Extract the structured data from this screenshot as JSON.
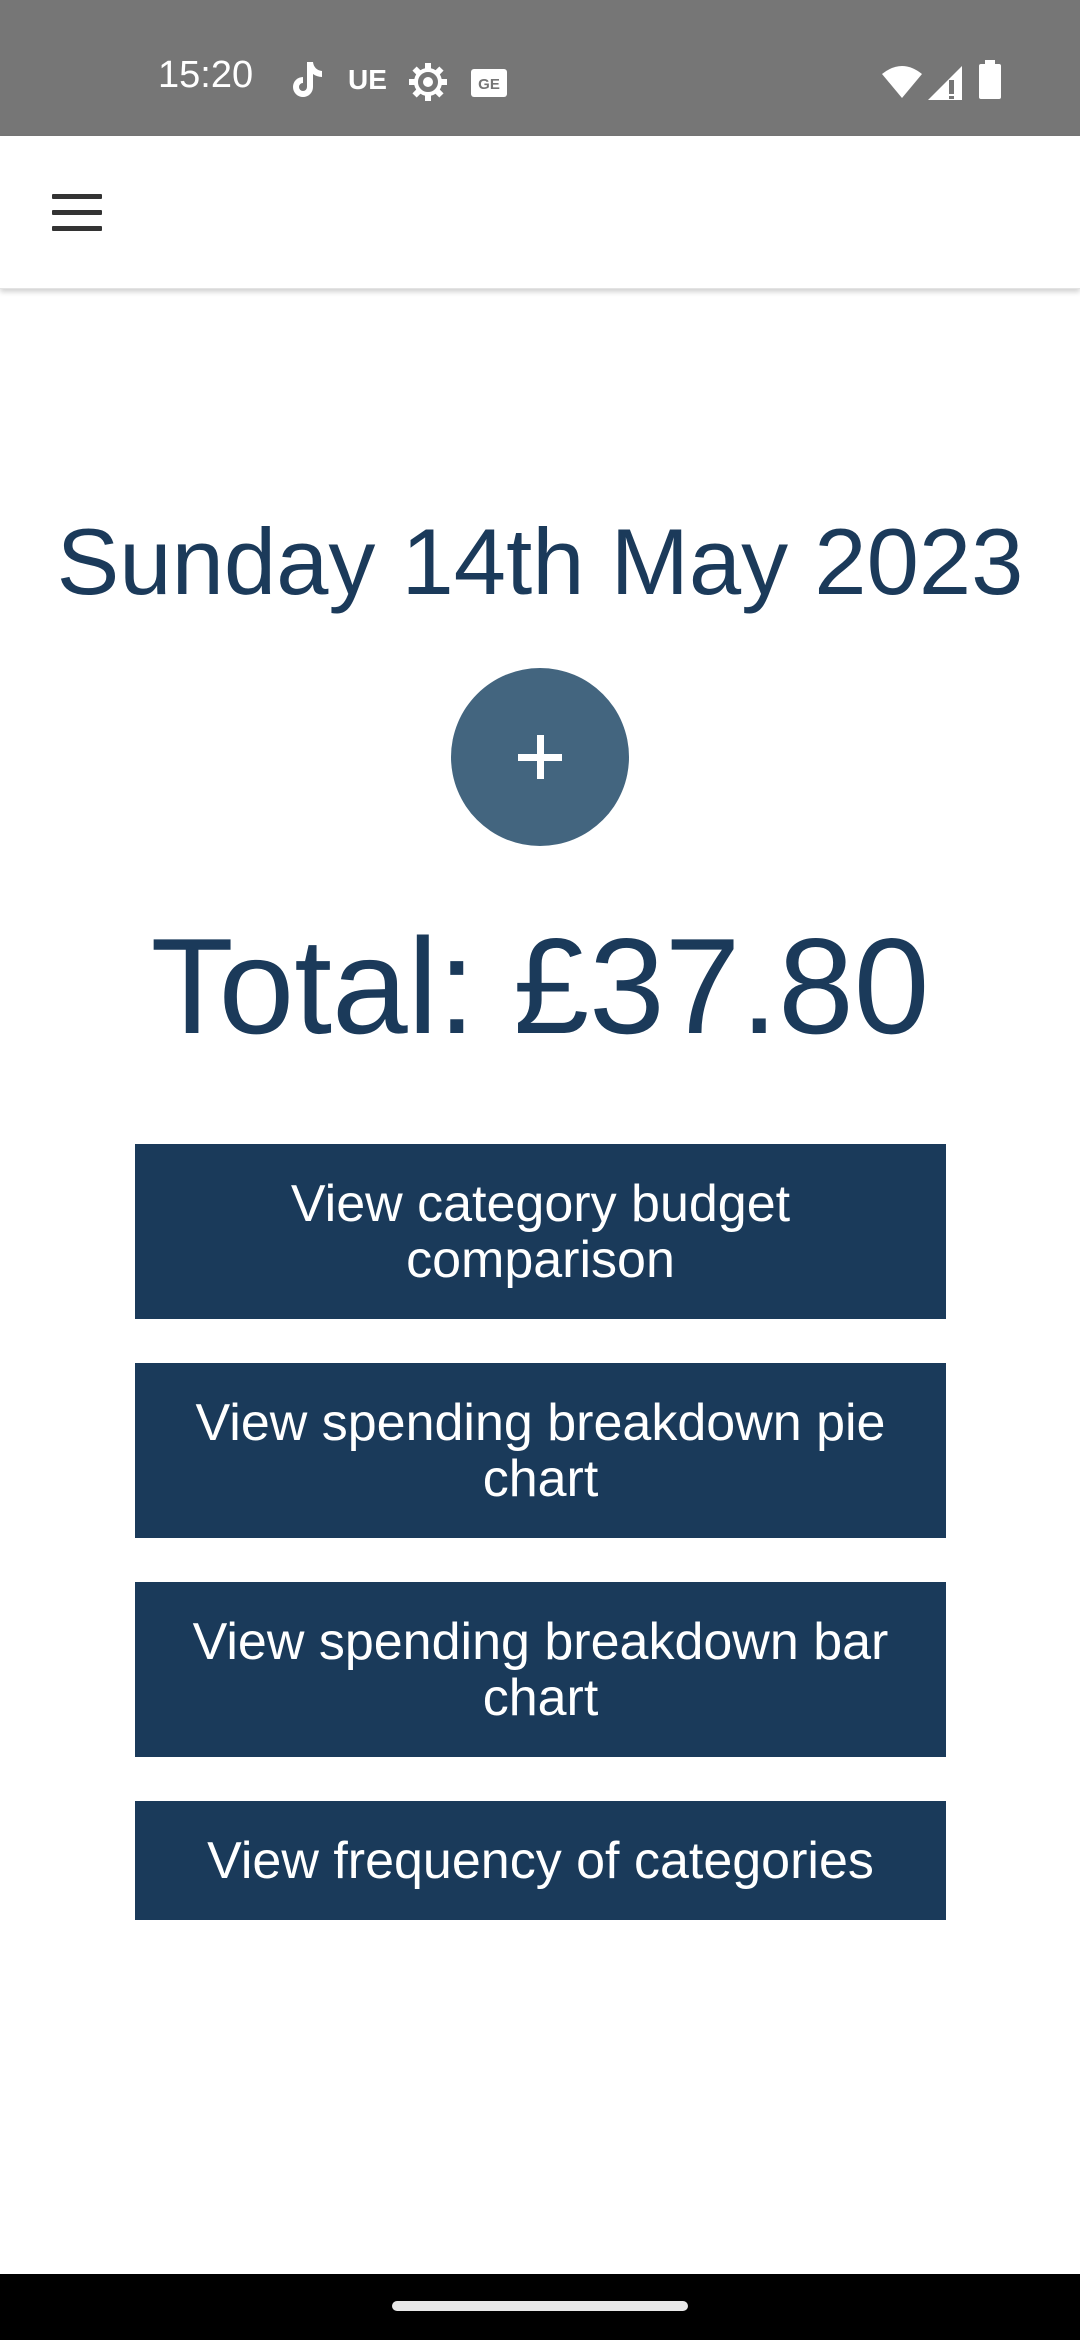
{
  "status_bar": {
    "time": "15:20",
    "notification_icons": [
      "tiktok-icon",
      "ue-icon",
      "settings-gear-icon",
      "ge-icon"
    ],
    "ue_label": "UE",
    "system_icons": [
      "wifi-icon",
      "signal-icon",
      "battery-icon"
    ]
  },
  "app_bar": {
    "menu_icon": "hamburger-menu-icon"
  },
  "main": {
    "date": "Sunday 14th May 2023",
    "add_button_icon": "plus-icon",
    "total": "Total: £37.80",
    "buttons": [
      {
        "label": "View category budget comparison"
      },
      {
        "label": "View spending breakdown pie chart"
      },
      {
        "label": "View spending breakdown bar chart"
      },
      {
        "label": "View frequency of categories"
      }
    ]
  },
  "colors": {
    "primary": "#1a3a5a",
    "add_button": "#43657f",
    "status_bar": "#767676"
  }
}
